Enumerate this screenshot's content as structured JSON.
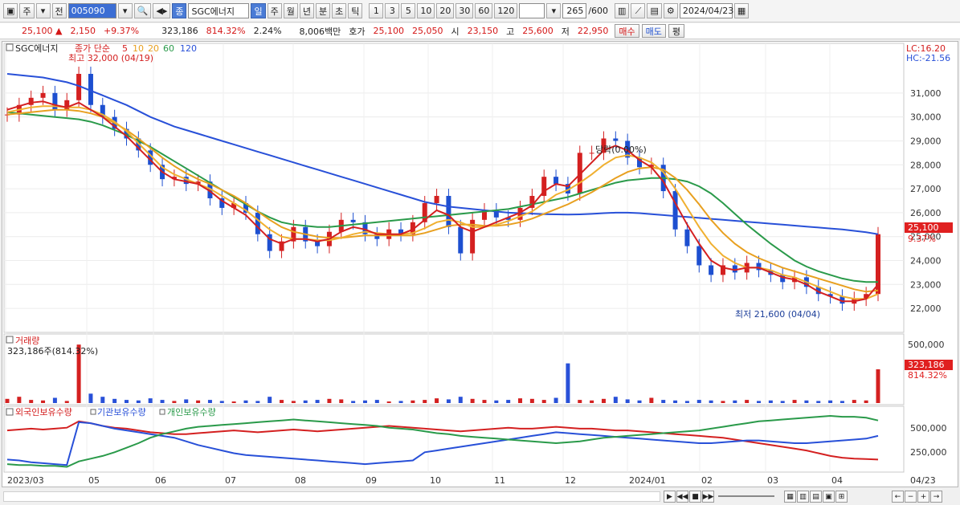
{
  "toolbar": {
    "market": "주",
    "prev": "전",
    "code": "005090",
    "badge": "종",
    "stock_name": "SGC에너지",
    "periods": [
      "일",
      "주",
      "월",
      "년",
      "분",
      "초",
      "틱"
    ],
    "intervals": [
      "1",
      "3",
      "5",
      "10",
      "20",
      "30",
      "60",
      "120"
    ],
    "count": "265",
    "count_total": "/600",
    "date": "2024/04/23"
  },
  "quote": {
    "price": "25,100",
    "change": "2,150",
    "change_pct": "+9.37%",
    "volume": "323,186",
    "volume_pct": "814.32%",
    "turnover": "2.24%",
    "amount": "8,006백만",
    "bid_label": "호가",
    "ask": "25,100",
    "bid": "25,050",
    "open_label": "시",
    "open": "23,150",
    "high_label": "고",
    "high": "25,600",
    "low_label": "저",
    "low": "22,950",
    "buy_btn": "매수",
    "sell_btn": "매도",
    "eval_btn": "평"
  },
  "chart_data": {
    "type": "line",
    "title": "SGC에너지",
    "legend": {
      "label": "종가 단순",
      "periods": [
        "5",
        "10",
        "20",
        "60",
        "120"
      ],
      "colors": [
        "#d42020",
        "#e8a020",
        "#e8a020",
        "#2a9a4a",
        "#2850d8"
      ]
    },
    "lc_label": "LC:16.20",
    "hc_label": "HC:-21.56",
    "price_axis": [
      "31,000",
      "30,000",
      "29,000",
      "28,000",
      "27,000",
      "26,000",
      "25,000",
      "24,000",
      "23,000",
      "22,000"
    ],
    "ylim": [
      21400,
      31800
    ],
    "current_price": "25,100",
    "current_pct": "9.37%",
    "max_label": "최고 32,000 (04/19)",
    "min_label": "최저 21,600 (04/04)",
    "marker_label": "당락(0.00%)",
    "x_labels": [
      "2023/03",
      "05",
      "06",
      "07",
      "08",
      "09",
      "10",
      "11",
      "12",
      "2024/01",
      "02",
      "03",
      "04",
      "04/23"
    ],
    "close": [
      30100,
      30500,
      30800,
      31000,
      30300,
      30700,
      31800,
      30500,
      30000,
      29500,
      29100,
      28600,
      28000,
      27400,
      27500,
      27200,
      27300,
      26600,
      26200,
      26400,
      26000,
      25100,
      24400,
      24800,
      25400,
      24800,
      24600,
      25200,
      25700,
      25600,
      25100,
      24900,
      25300,
      25100,
      25600,
      26400,
      26700,
      25400,
      24300,
      25700,
      26100,
      25800,
      25700,
      26200,
      26700,
      27500,
      27200,
      26800,
      28500,
      28500,
      29100,
      29000,
      28300,
      27900,
      28000,
      26900,
      25300,
      24600,
      23800,
      23400,
      23800,
      23500,
      23900,
      23600,
      23400,
      23100,
      23300,
      22900,
      22600,
      22500,
      22200,
      22400,
      22600,
      25100
    ],
    "ma5": [
      30300,
      30450,
      30600,
      30650,
      30500,
      30400,
      30600,
      30300,
      30000,
      29600,
      29200,
      28700,
      28200,
      27700,
      27400,
      27300,
      27200,
      26900,
      26500,
      26200,
      25900,
      25400,
      24900,
      24700,
      24900,
      24900,
      24800,
      24900,
      25200,
      25400,
      25300,
      25100,
      25100,
      25100,
      25300,
      25700,
      26100,
      25900,
      25400,
      25200,
      25400,
      25600,
      25800,
      26000,
      26300,
      26900,
      27200,
      27100,
      27600,
      28100,
      28600,
      28800,
      28600,
      28200,
      27900,
      27300,
      26400,
      25500,
      24700,
      24000,
      23700,
      23600,
      23700,
      23700,
      23500,
      23300,
      23200,
      23000,
      22700,
      22500,
      22300,
      22300,
      22400,
      23000
    ],
    "ma10": [
      30200,
      30300,
      30400,
      30450,
      30450,
      30400,
      30400,
      30300,
      30100,
      29800,
      29400,
      28900,
      28400,
      27900,
      27600,
      27400,
      27200,
      27000,
      26700,
      26400,
      26100,
      25700,
      25300,
      25000,
      24900,
      24900,
      24850,
      24850,
      24950,
      25100,
      25200,
      25150,
      25100,
      25100,
      25150,
      25350,
      25600,
      25700,
      25600,
      25400,
      25400,
      25500,
      25650,
      25850,
      26050,
      26400,
      26750,
      26950,
      27250,
      27600,
      28000,
      28300,
      28400,
      28300,
      28100,
      27700,
      27000,
      26200,
      25400,
      24700,
      24200,
      23900,
      23700,
      23700,
      23600,
      23400,
      23300,
      23100,
      22900,
      22700,
      22500,
      22400,
      22400,
      22600
    ],
    "ma20": [
      30100,
      30150,
      30200,
      30250,
      30300,
      30300,
      30250,
      30150,
      30000,
      29750,
      29450,
      29100,
      28700,
      28300,
      27950,
      27650,
      27400,
      27200,
      26950,
      26700,
      26400,
      26050,
      25700,
      25400,
      25200,
      25100,
      25000,
      24950,
      24950,
      25000,
      25050,
      25050,
      25050,
      25050,
      25050,
      25150,
      25300,
      25450,
      25500,
      25500,
      25450,
      25450,
      25500,
      25600,
      25750,
      25950,
      26150,
      26350,
      26600,
      26850,
      27150,
      27450,
      27700,
      27850,
      27900,
      27800,
      27450,
      26950,
      26350,
      25700,
      25150,
      24700,
      24350,
      24100,
      23900,
      23700,
      23550,
      23400,
      23250,
      23100,
      22950,
      22800,
      22700,
      22750
    ],
    "ma60": [
      30200,
      30150,
      30100,
      30050,
      30000,
      29950,
      29900,
      29800,
      29650,
      29450,
      29250,
      29000,
      28750,
      28450,
      28150,
      27850,
      27550,
      27250,
      26950,
      26650,
      26350,
      26050,
      25800,
      25600,
      25500,
      25450,
      25400,
      25400,
      25450,
      25500,
      25550,
      25600,
      25650,
      25700,
      25750,
      25800,
      25850,
      25900,
      25950,
      26000,
      26050,
      26100,
      26150,
      26250,
      26350,
      26450,
      26550,
      26650,
      26800,
      26950,
      27100,
      27250,
      27350,
      27400,
      27450,
      27450,
      27400,
      27300,
      27100,
      26800,
      26400,
      25950,
      25500,
      25100,
      24700,
      24350,
      24000,
      23750,
      23550,
      23400,
      23250,
      23150,
      23100,
      23100
    ],
    "ma120": [
      31800,
      31750,
      31700,
      31650,
      31550,
      31450,
      31300,
      31100,
      30900,
      30700,
      30500,
      30250,
      30000,
      29800,
      29600,
      29450,
      29300,
      29150,
      29000,
      28850,
      28700,
      28550,
      28400,
      28250,
      28100,
      27950,
      27800,
      27650,
      27500,
      27350,
      27200,
      27050,
      26900,
      26750,
      26600,
      26450,
      26350,
      26250,
      26200,
      26150,
      26100,
      26050,
      26000,
      25980,
      25960,
      25940,
      25930,
      25920,
      25930,
      25950,
      25980,
      26000,
      26000,
      25980,
      25940,
      25900,
      25860,
      25820,
      25780,
      25740,
      25700,
      25660,
      25620,
      25580,
      25540,
      25500,
      25460,
      25420,
      25380,
      25340,
      25300,
      25240,
      25180,
      25100
    ],
    "volume_panel": {
      "title": "거래량",
      "current": "323,186주(814.32%)",
      "axis": [
        "500,000"
      ],
      "current_value": "323,186",
      "current_pct": "814.32%",
      "ylim": [
        0,
        600000
      ],
      "values": [
        40000,
        60000,
        30000,
        25000,
        50000,
        20000,
        560000,
        90000,
        60000,
        40000,
        30000,
        25000,
        45000,
        30000,
        20000,
        35000,
        25000,
        30000,
        20000,
        15000,
        25000,
        20000,
        60000,
        30000,
        20000,
        25000,
        30000,
        40000,
        35000,
        20000,
        25000,
        30000,
        15000,
        20000,
        25000,
        30000,
        45000,
        35000,
        60000,
        40000,
        30000,
        25000,
        30000,
        45000,
        40000,
        30000,
        50000,
        380000,
        30000,
        25000,
        40000,
        60000,
        35000,
        25000,
        50000,
        30000,
        25000,
        20000,
        30000,
        25000,
        20000,
        25000,
        30000,
        20000,
        25000,
        20000,
        30000,
        25000,
        20000,
        25000,
        20000,
        30000,
        25000,
        323186
      ]
    },
    "holdings_panel": {
      "series": [
        {
          "name": "외국인보유수량",
          "color": "#d42020"
        },
        {
          "name": "기관보유수량",
          "color": "#2850d8"
        },
        {
          "name": "개인보유수량",
          "color": "#2a9a4a"
        }
      ],
      "axis": [
        "500,000",
        "250,000"
      ],
      "ylim": [
        100000,
        700000
      ],
      "foreign": [
        540000,
        550000,
        560000,
        550000,
        560000,
        570000,
        640000,
        620000,
        590000,
        570000,
        560000,
        540000,
        520000,
        510000,
        500000,
        500000,
        510000,
        520000,
        530000,
        540000,
        530000,
        520000,
        530000,
        540000,
        550000,
        540000,
        530000,
        540000,
        550000,
        560000,
        570000,
        580000,
        590000,
        580000,
        570000,
        560000,
        550000,
        540000,
        530000,
        540000,
        550000,
        560000,
        570000,
        560000,
        560000,
        570000,
        580000,
        570000,
        560000,
        560000,
        550000,
        540000,
        540000,
        530000,
        520000,
        510000,
        500000,
        490000,
        480000,
        470000,
        460000,
        440000,
        420000,
        400000,
        380000,
        360000,
        340000,
        320000,
        290000,
        260000,
        240000,
        230000,
        225000,
        220000
      ],
      "institution": [
        220000,
        210000,
        190000,
        180000,
        170000,
        160000,
        630000,
        620000,
        590000,
        560000,
        540000,
        520000,
        500000,
        480000,
        460000,
        420000,
        380000,
        350000,
        320000,
        290000,
        270000,
        260000,
        250000,
        240000,
        230000,
        220000,
        210000,
        200000,
        190000,
        180000,
        170000,
        180000,
        190000,
        200000,
        210000,
        300000,
        320000,
        340000,
        360000,
        380000,
        400000,
        420000,
        440000,
        460000,
        480000,
        500000,
        520000,
        510000,
        500000,
        490000,
        480000,
        470000,
        460000,
        450000,
        440000,
        430000,
        420000,
        410000,
        400000,
        400000,
        410000,
        420000,
        430000,
        430000,
        420000,
        410000,
        400000,
        400000,
        410000,
        420000,
        430000,
        440000,
        450000,
        480000
      ],
      "individual": [
        170000,
        160000,
        160000,
        150000,
        150000,
        140000,
        200000,
        230000,
        260000,
        300000,
        350000,
        400000,
        460000,
        500000,
        530000,
        560000,
        580000,
        590000,
        600000,
        610000,
        620000,
        630000,
        640000,
        650000,
        660000,
        650000,
        640000,
        630000,
        620000,
        610000,
        600000,
        590000,
        570000,
        560000,
        550000,
        530000,
        510000,
        500000,
        480000,
        470000,
        460000,
        450000,
        440000,
        430000,
        420000,
        410000,
        400000,
        410000,
        420000,
        440000,
        460000,
        470000,
        480000,
        490000,
        500000,
        510000,
        520000,
        530000,
        540000,
        560000,
        580000,
        600000,
        620000,
        640000,
        650000,
        660000,
        670000,
        680000,
        690000,
        700000,
        690000,
        690000,
        680000,
        650000
      ]
    }
  }
}
